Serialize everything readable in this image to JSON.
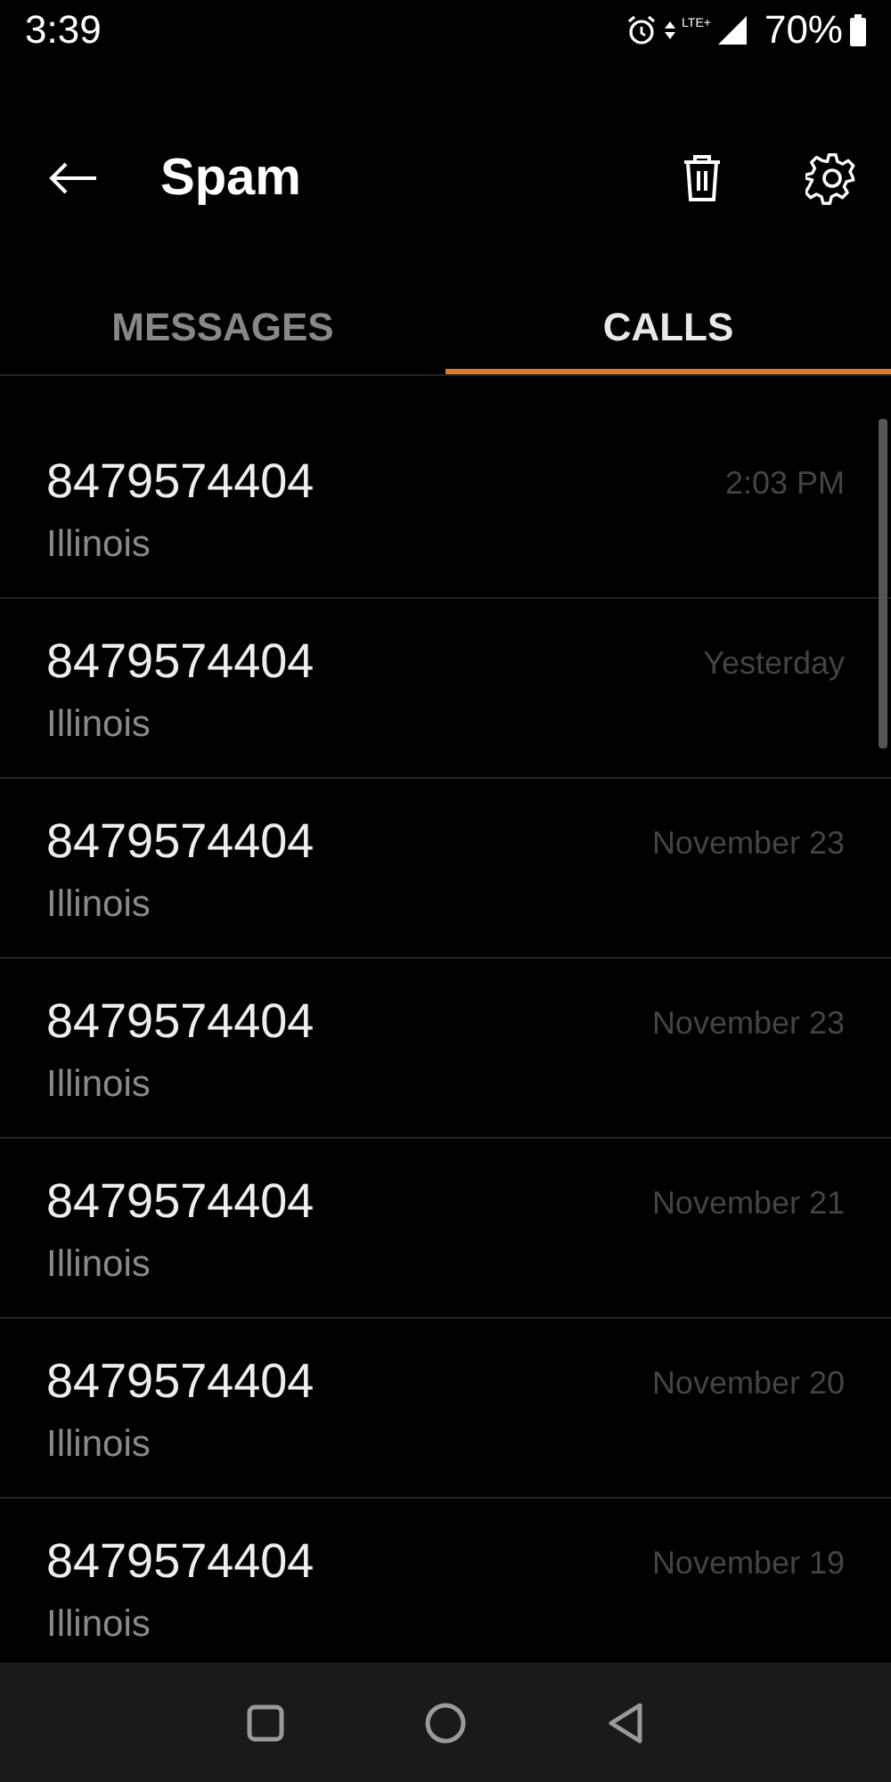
{
  "status_bar": {
    "time": "3:39",
    "network": "LTE+",
    "battery": "70%"
  },
  "app_bar": {
    "title": "Spam"
  },
  "tabs": [
    {
      "label": "MESSAGES",
      "selected": false
    },
    {
      "label": "CALLS",
      "selected": true
    }
  ],
  "calls": [
    {
      "number": "8479574404",
      "location": "Illinois",
      "time": "2:03 PM"
    },
    {
      "number": "8479574404",
      "location": "Illinois",
      "time": "Yesterday"
    },
    {
      "number": "8479574404",
      "location": "Illinois",
      "time": "November 23"
    },
    {
      "number": "8479574404",
      "location": "Illinois",
      "time": "November 23"
    },
    {
      "number": "8479574404",
      "location": "Illinois",
      "time": "November 21"
    },
    {
      "number": "8479574404",
      "location": "Illinois",
      "time": "November 20"
    },
    {
      "number": "8479574404",
      "location": "Illinois",
      "time": "November 19"
    }
  ]
}
